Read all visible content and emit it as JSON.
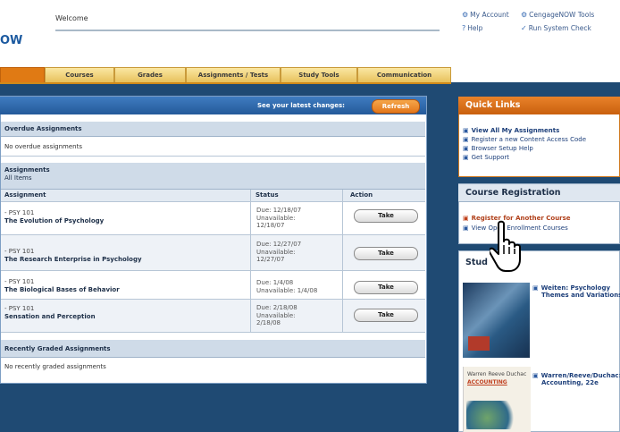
{
  "header": {
    "welcome": "Welcome",
    "brand": "OW",
    "links": [
      {
        "icon": "gear-icon",
        "glyph": "⚙",
        "label": "My Account"
      },
      {
        "icon": "gear-icon",
        "glyph": "⚙",
        "label": "CengageNOW Tools"
      },
      {
        "icon": "help-icon",
        "glyph": "?",
        "label": "Help"
      },
      {
        "icon": "check-icon",
        "glyph": "✓",
        "label": "Run System Check"
      }
    ]
  },
  "tabs": [
    "",
    "Courses",
    "Grades",
    "Assignments / Tests",
    "Study Tools",
    "Communication"
  ],
  "changes": {
    "label": "See your latest changes:",
    "refresh": "Refresh"
  },
  "overdue": {
    "heading": "Overdue Assignments",
    "empty": "No overdue assignments"
  },
  "assignments": {
    "heading": "Assignments",
    "subheading": "All Items",
    "columns": {
      "assignment": "Assignment",
      "status": "Status",
      "action": "Action"
    },
    "rows": [
      {
        "course": "PSY 101",
        "title": "The Evolution of Psychology",
        "status": [
          "Due: 12/18/07",
          "Unavailable:",
          "12/18/07"
        ],
        "action": "Take"
      },
      {
        "course": "PSY 101",
        "title": "The Research Enterprise in Psychology",
        "status": [
          "Due: 12/27/07",
          "Unavailable:",
          "12/27/07"
        ],
        "action": "Take"
      },
      {
        "course": "PSY 101",
        "title": "The Biological Bases of Behavior",
        "status": [
          "Due: 1/4/08",
          "Unavailable: 1/4/08"
        ],
        "action": "Take"
      },
      {
        "course": "PSY 101",
        "title": "Sensation and Perception",
        "status": [
          "Due: 2/18/08",
          "Unavailable:",
          "2/18/08"
        ],
        "action": "Take"
      }
    ]
  },
  "graded": {
    "heading": "Recently Graded Assignments",
    "empty": "No recently graded assignments"
  },
  "quick_links": {
    "heading": "Quick Links",
    "items": [
      "View All My Assignments",
      "Register a new Content Access Code",
      "Browser Setup Help",
      "Get Support"
    ]
  },
  "course_registration": {
    "heading": "Course Registration",
    "items": [
      "Register for Another Course",
      "View Open Enrollment Courses"
    ]
  },
  "study": {
    "heading": "Stud",
    "books": [
      {
        "title": "Weiten: Psychology",
        "subtitle": "Themes and Variations"
      },
      {
        "title": "Warren/Reeve/Duchac:",
        "subtitle": "Accounting, 22e"
      }
    ],
    "cover2_text": "Warren Reeve Duchac",
    "cover2_sub": "ACCOUNTING"
  },
  "colors": {
    "tab_active": "#e07a14",
    "panel_head": "#245a9a",
    "accent": "#e3761a"
  }
}
